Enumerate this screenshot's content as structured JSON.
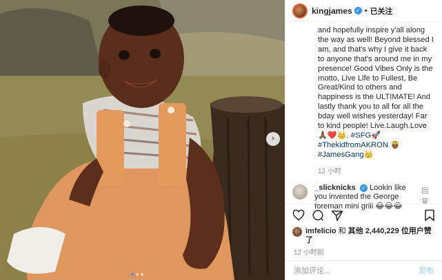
{
  "header": {
    "username": "kingjames",
    "separator": "•",
    "follow_status": "已关注"
  },
  "caption": {
    "line1": "and hopefully inspire y'all along the way as well! Beyond blessed I am, and that's why I give it back to anyone that's around me in my presence! Good Vibes Only is the motto, Live Life to Fullest, Be Great/Kind to others and happiness is the ULTIMATE! And lastly thank you to all for all the bday well wishes yesterday! Far to kind people! Live.Laugh.Love",
    "emoji1": "🙏🏾❤️👑.",
    "tag1": "#SFG",
    "emoji2": "🚀",
    "tag2": "#ThekidfromAKRON",
    "emoji3": "🤴🏾",
    "tag3": "#JamesGang",
    "emoji4": "👑",
    "time": "12 小时"
  },
  "comment": {
    "username": "_slicknicks",
    "text": "Lookin like you invented the George foreman mini grill",
    "emoji": "😂😂😂",
    "reply": "回复"
  },
  "likes": {
    "user": "imfelicio",
    "connector": "和",
    "others_label": "其他",
    "count": "2,440,229",
    "suffix": "位用户赞了"
  },
  "post_time": "12 小时前",
  "add_comment": {
    "placeholder": "添加评论...",
    "post_label": "发布"
  }
}
